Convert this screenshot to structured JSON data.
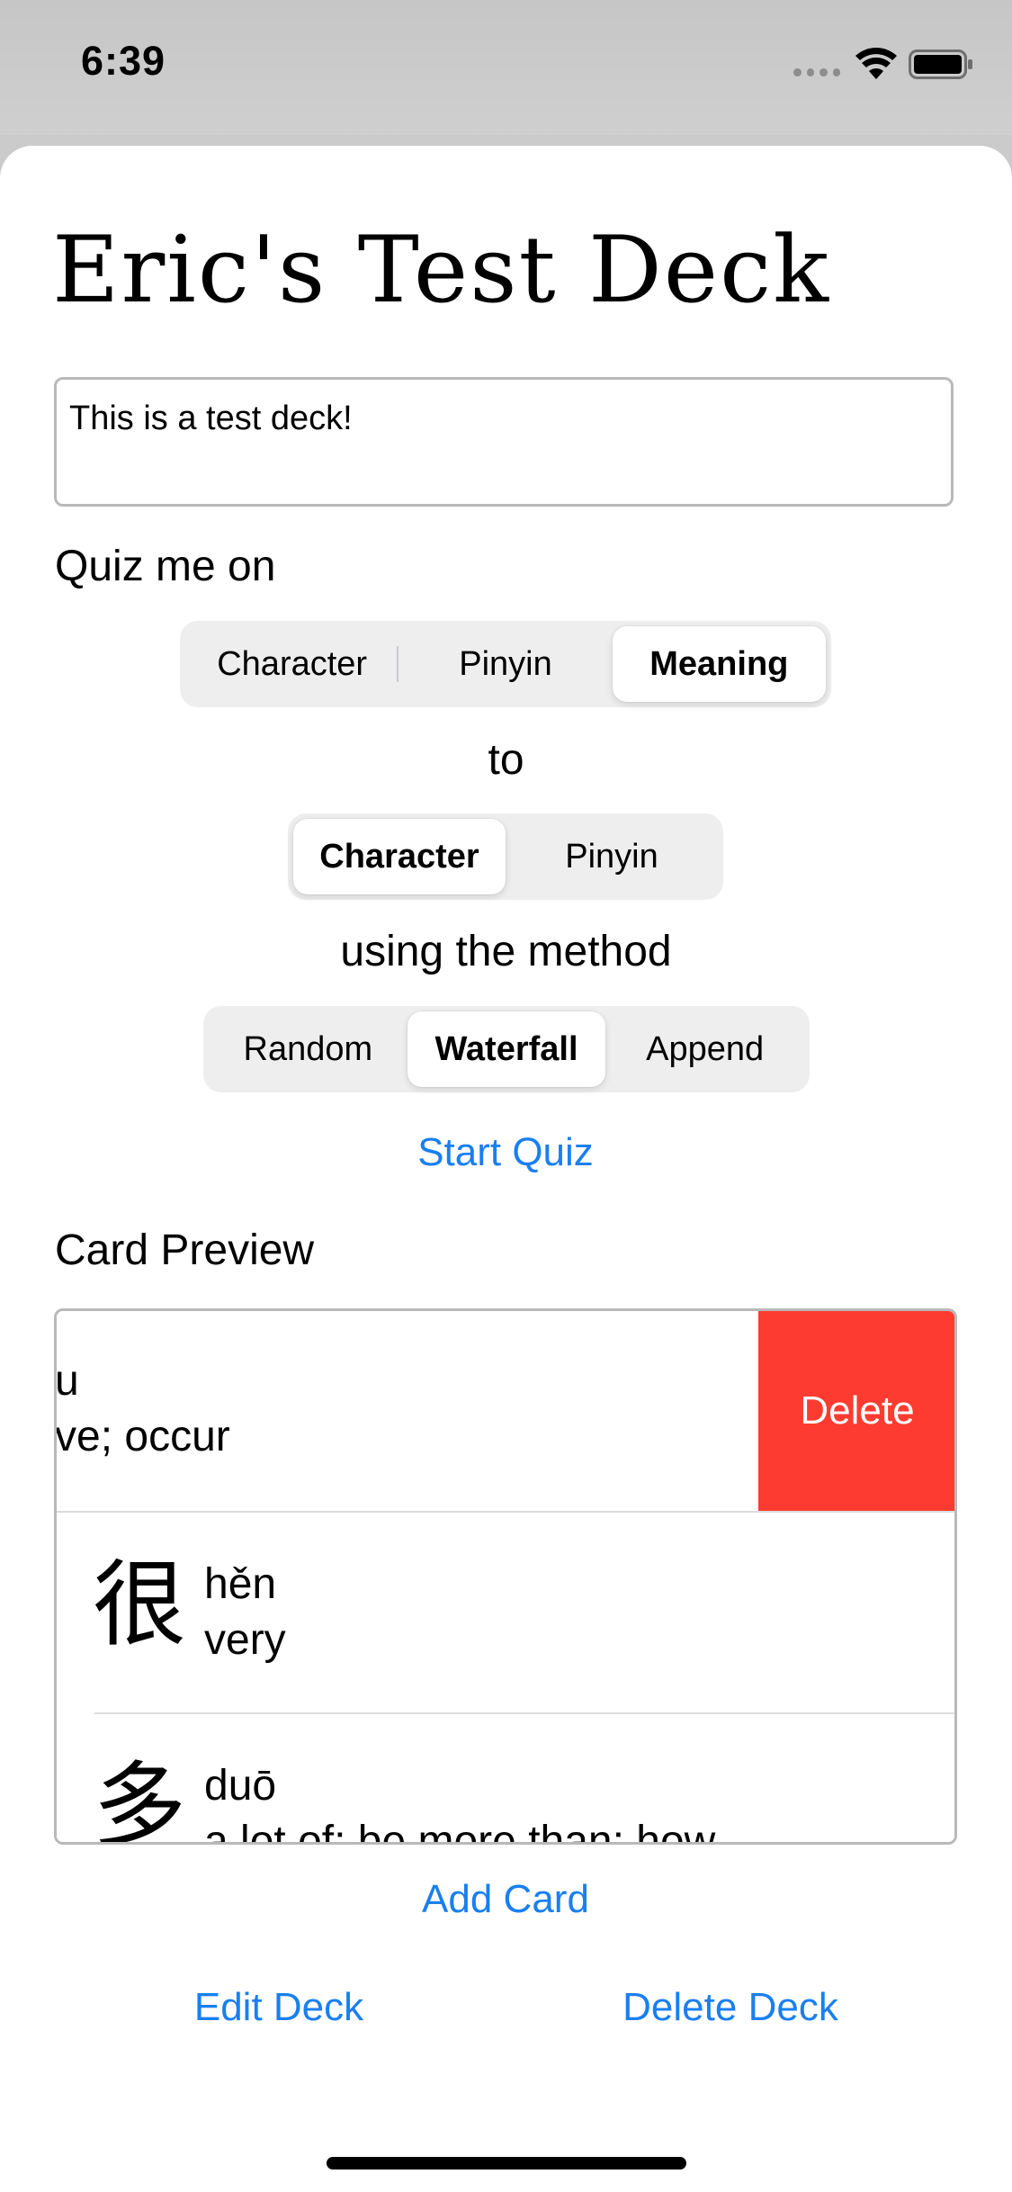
{
  "status_bar": {
    "time": "6:39",
    "icons": [
      "signal-icon",
      "wifi-icon",
      "battery-icon"
    ]
  },
  "deck": {
    "title": "Eric's Test Deck",
    "description": "This is a test deck!"
  },
  "quiz": {
    "quiz_me_on_label": "Quiz me on",
    "from_options": [
      "Character",
      "Pinyin",
      "Meaning"
    ],
    "from_selected": "Meaning",
    "to_label": "to",
    "to_options": [
      "Character",
      "Pinyin"
    ],
    "to_selected": "Character",
    "method_label": "using the method",
    "method_options": [
      "Random",
      "Waterfall",
      "Append"
    ],
    "method_selected": "Waterfall",
    "start_label": "Start Quiz"
  },
  "preview": {
    "label": "Card Preview",
    "cards": [
      {
        "character": "",
        "pinyin": "u",
        "meaning": "ve; occur"
      },
      {
        "character": "很",
        "pinyin": "hěn",
        "meaning": "very"
      },
      {
        "character": "多",
        "pinyin": "duō",
        "meaning": "a lot of; be more than; how"
      }
    ],
    "delete_action_label": "Delete"
  },
  "actions": {
    "add_card": "Add Card",
    "edit_deck": "Edit Deck",
    "delete_deck": "Delete Deck"
  },
  "colors": {
    "accent": "#1a7ff0",
    "destructive": "#fe3b30",
    "segment_bg": "#eeeeef"
  }
}
